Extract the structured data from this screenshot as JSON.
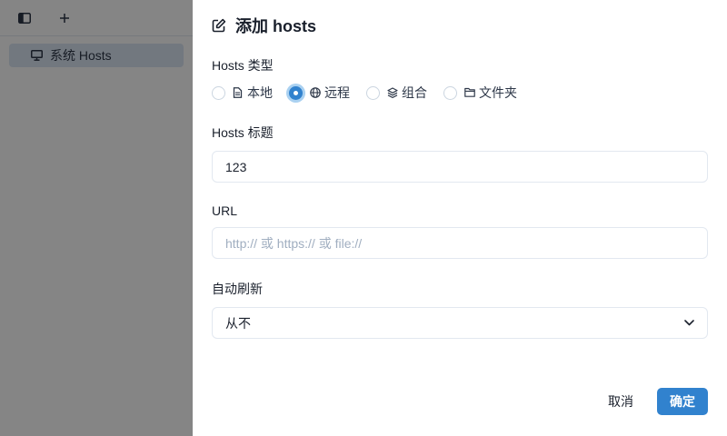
{
  "app": {
    "topbar": {
      "sidebar_toggle_icon": "sidebar-icon",
      "add_icon": "plus-icon"
    },
    "sidebar": {
      "items": [
        {
          "label": "系统 Hosts",
          "icon": "monitor-icon",
          "selected": true
        }
      ]
    }
  },
  "drawer": {
    "title": "添加 hosts",
    "title_icon": "edit-icon",
    "hosts_type": {
      "label": "Hosts 类型",
      "options": [
        {
          "label": "本地",
          "icon": "file-icon",
          "checked": false
        },
        {
          "label": "远程",
          "icon": "globe-icon",
          "checked": true
        },
        {
          "label": "组合",
          "icon": "layers-icon",
          "checked": false
        },
        {
          "label": "文件夹",
          "icon": "folder-icon",
          "checked": false
        }
      ]
    },
    "hosts_title": {
      "label": "Hosts 标题",
      "value": "123"
    },
    "url": {
      "label": "URL",
      "value": "",
      "placeholder": "http:// 或 https:// 或 file://"
    },
    "auto_refresh": {
      "label": "自动刷新",
      "selected": "从不"
    },
    "footer": {
      "cancel_label": "取消",
      "ok_label": "确定"
    }
  },
  "colors": {
    "accent": "#3182ce",
    "overlay": "#00000080",
    "sidebar_selected": "#dbe6f3"
  }
}
